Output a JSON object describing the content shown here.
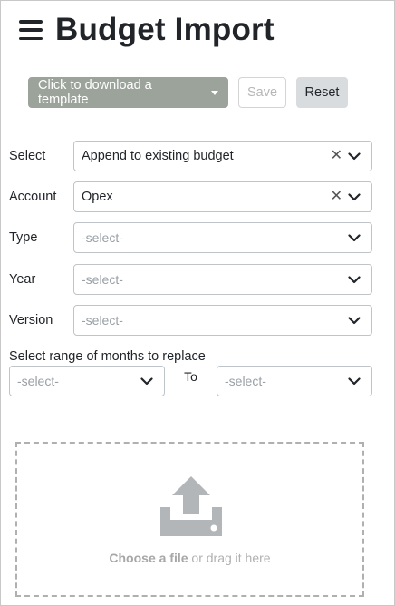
{
  "header": {
    "title": "Budget Import",
    "menu_icon": "hamburger-menu-icon"
  },
  "toolbar": {
    "template_label": "Click to download a template",
    "save_label": "Save",
    "reset_label": "Reset"
  },
  "form": {
    "select": {
      "label": "Select",
      "value": "Append to existing budget"
    },
    "account": {
      "label": "Account",
      "value": "Opex"
    },
    "type": {
      "label": "Type",
      "placeholder": "-select-"
    },
    "year": {
      "label": "Year",
      "placeholder": "-select-"
    },
    "version": {
      "label": "Version",
      "placeholder": "-select-"
    }
  },
  "range": {
    "label": "Select range of months to replace",
    "from_placeholder": "-select-",
    "to_label": "To",
    "to_placeholder": "-select-"
  },
  "dropzone": {
    "choose_label": "Choose a file",
    "drag_label": " or drag it here"
  },
  "colors": {
    "template_button": "#9ca39b",
    "reset_button": "#d9dcde",
    "upload_icon": "#b3b6b9"
  }
}
